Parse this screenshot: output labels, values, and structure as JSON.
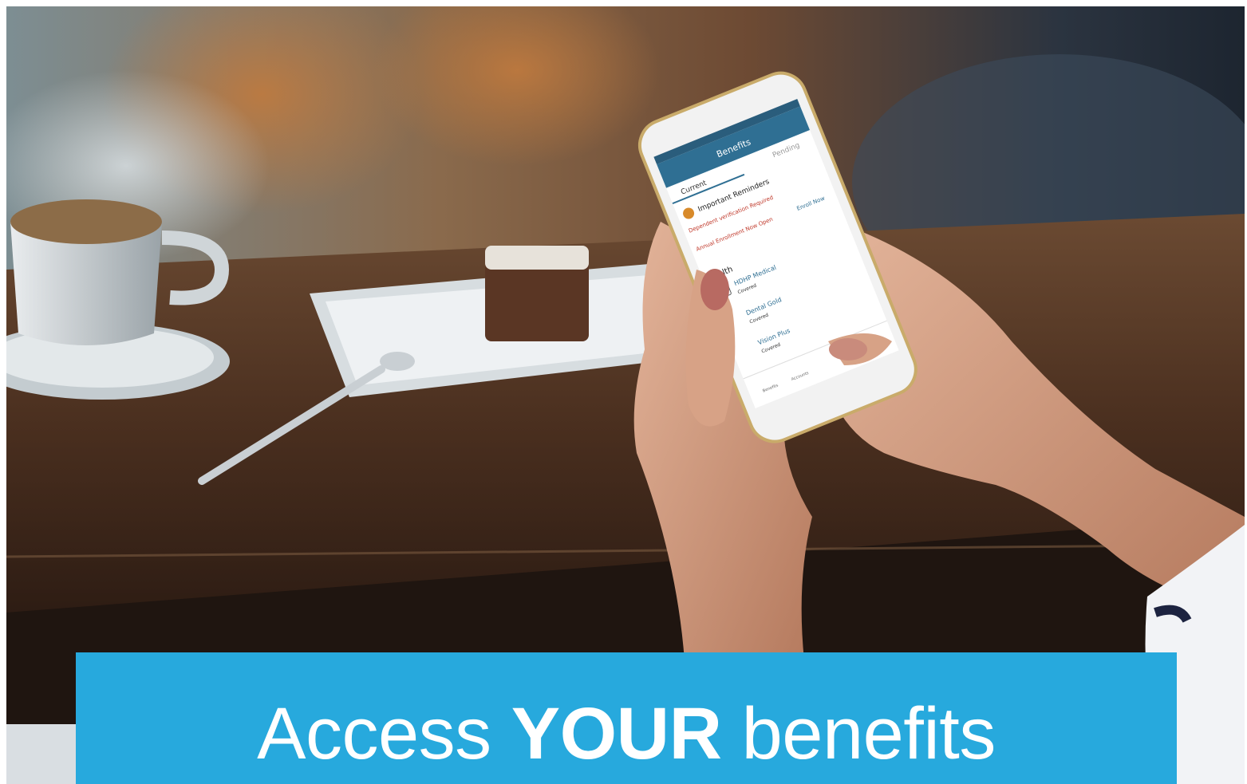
{
  "banner": {
    "part1": "Access",
    "part2": "YOUR",
    "part3": "benefits",
    "color": "#27a9dd"
  },
  "phone": {
    "title": "Benefits",
    "tabs": [
      "Current",
      "Pending"
    ],
    "reminders_heading": "Important Reminders",
    "reminder1": "Dependent verification Required",
    "reminder2": "Annual Enrollment Now Open",
    "enroll_link": "Enroll Now",
    "health_heading": "Health",
    "plans": [
      {
        "name": "HDHP Medical",
        "status": "Covered"
      },
      {
        "name": "Dental Gold",
        "status": "Covered"
      },
      {
        "name": "Vision Plus",
        "status": "Covered"
      }
    ],
    "nav": [
      "Benefits",
      "Accounts"
    ]
  }
}
